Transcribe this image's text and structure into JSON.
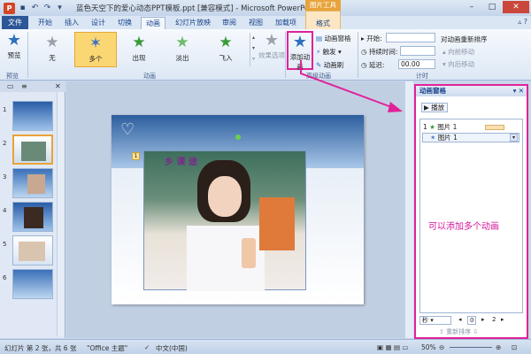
{
  "window": {
    "title": "蓝色天空下的爱心动态PPT模板.ppt [兼容模式] - Microsoft PowerPoint",
    "tool_tab_header": "图片工具",
    "controls": [
      "–",
      "□",
      "✕"
    ]
  },
  "tabs": {
    "file": "文件",
    "items": [
      "开始",
      "插入",
      "设计",
      "切换",
      "动画",
      "幻灯片放映",
      "审阅",
      "视图",
      "加载项"
    ],
    "active": "动画",
    "format": "格式"
  },
  "ribbon": {
    "preview": {
      "label": "预览",
      "group": "预览"
    },
    "animations": {
      "group": "动画",
      "items": [
        {
          "label": "无",
          "icon": "star-gray-icon"
        },
        {
          "label": "多个",
          "icon": "star-multi-icon"
        },
        {
          "label": "出现",
          "icon": "star-green-icon"
        },
        {
          "label": "淡出",
          "icon": "star-green-icon"
        },
        {
          "label": "飞入",
          "icon": "star-green-icon"
        }
      ],
      "selected": "多个",
      "effect_options": "效果选项"
    },
    "advanced": {
      "group": "高级动画",
      "add_animation": "添加动画",
      "anim_pane": "动画窗格",
      "trigger": "触发",
      "anim_painter": "动画刷"
    },
    "timing": {
      "group": "计时",
      "start_label": "开始:",
      "start_value": "",
      "duration_label": "持续时间:",
      "duration_value": "",
      "delay_label": "延迟:",
      "delay_value": "00.00",
      "reorder_title": "对动画重新排序",
      "move_earlier": "向前移动",
      "move_later": "向后移动"
    }
  },
  "slides_pane": {
    "thumbnails": [
      "1",
      "2",
      "3",
      "4",
      "5",
      "6"
    ],
    "active_slide": "2"
  },
  "animation_pane": {
    "title": "动画窗格",
    "play": "播放",
    "items": [
      {
        "index": "1",
        "name": "图片 1"
      },
      {
        "index": "",
        "name": "图片 1"
      }
    ],
    "annotation": "可以添加多个动画",
    "seconds_label": "秒",
    "seconds_start": "0",
    "seconds_end": "2",
    "reorder_label": "重新排序"
  },
  "slide": {
    "heading_text": "乡 课 途"
  },
  "statusbar": {
    "slide_info": "幻灯片 第 2 张，共 6 张",
    "theme": "\"Office 主题\"",
    "language": "中文(中国)",
    "zoom": "50%"
  },
  "colors": {
    "annotation_pink": "#e0229a",
    "file_tab": "#2b5797",
    "tool_tab": "#e8a33a"
  }
}
